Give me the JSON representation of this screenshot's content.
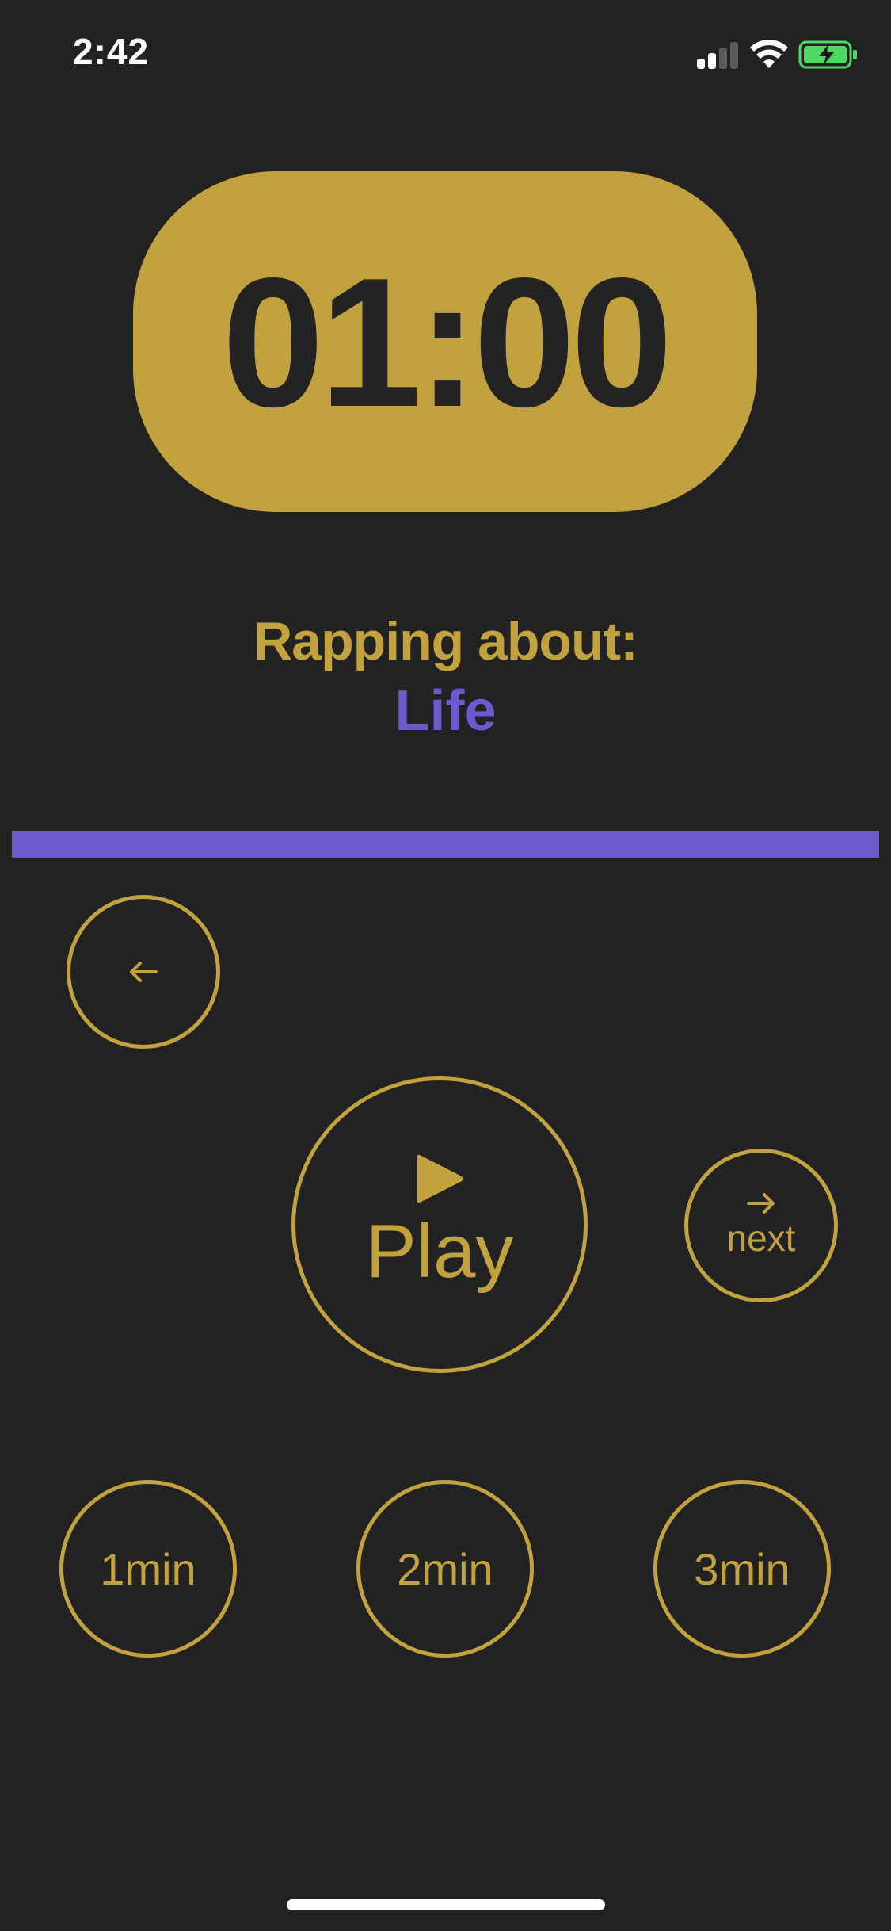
{
  "status_bar": {
    "time": "2:42",
    "signal_bars_active": 2,
    "signal_bars_total": 4,
    "battery_charging": true
  },
  "timer": {
    "display": "01:00"
  },
  "topic": {
    "label": "Rapping about:",
    "value": "Life"
  },
  "progress": {
    "fraction": 1.0
  },
  "controls": {
    "back_icon": "arrow-left-icon",
    "play_icon": "play-icon",
    "play_label": "Play",
    "next_icon": "arrow-right-icon",
    "next_label": "next"
  },
  "durations": [
    "1min",
    "2min",
    "3min"
  ],
  "colors": {
    "background": "#222222",
    "accent_gold": "#c2a23e",
    "accent_purple": "#6a5acd",
    "battery_green": "#4cd964"
  }
}
